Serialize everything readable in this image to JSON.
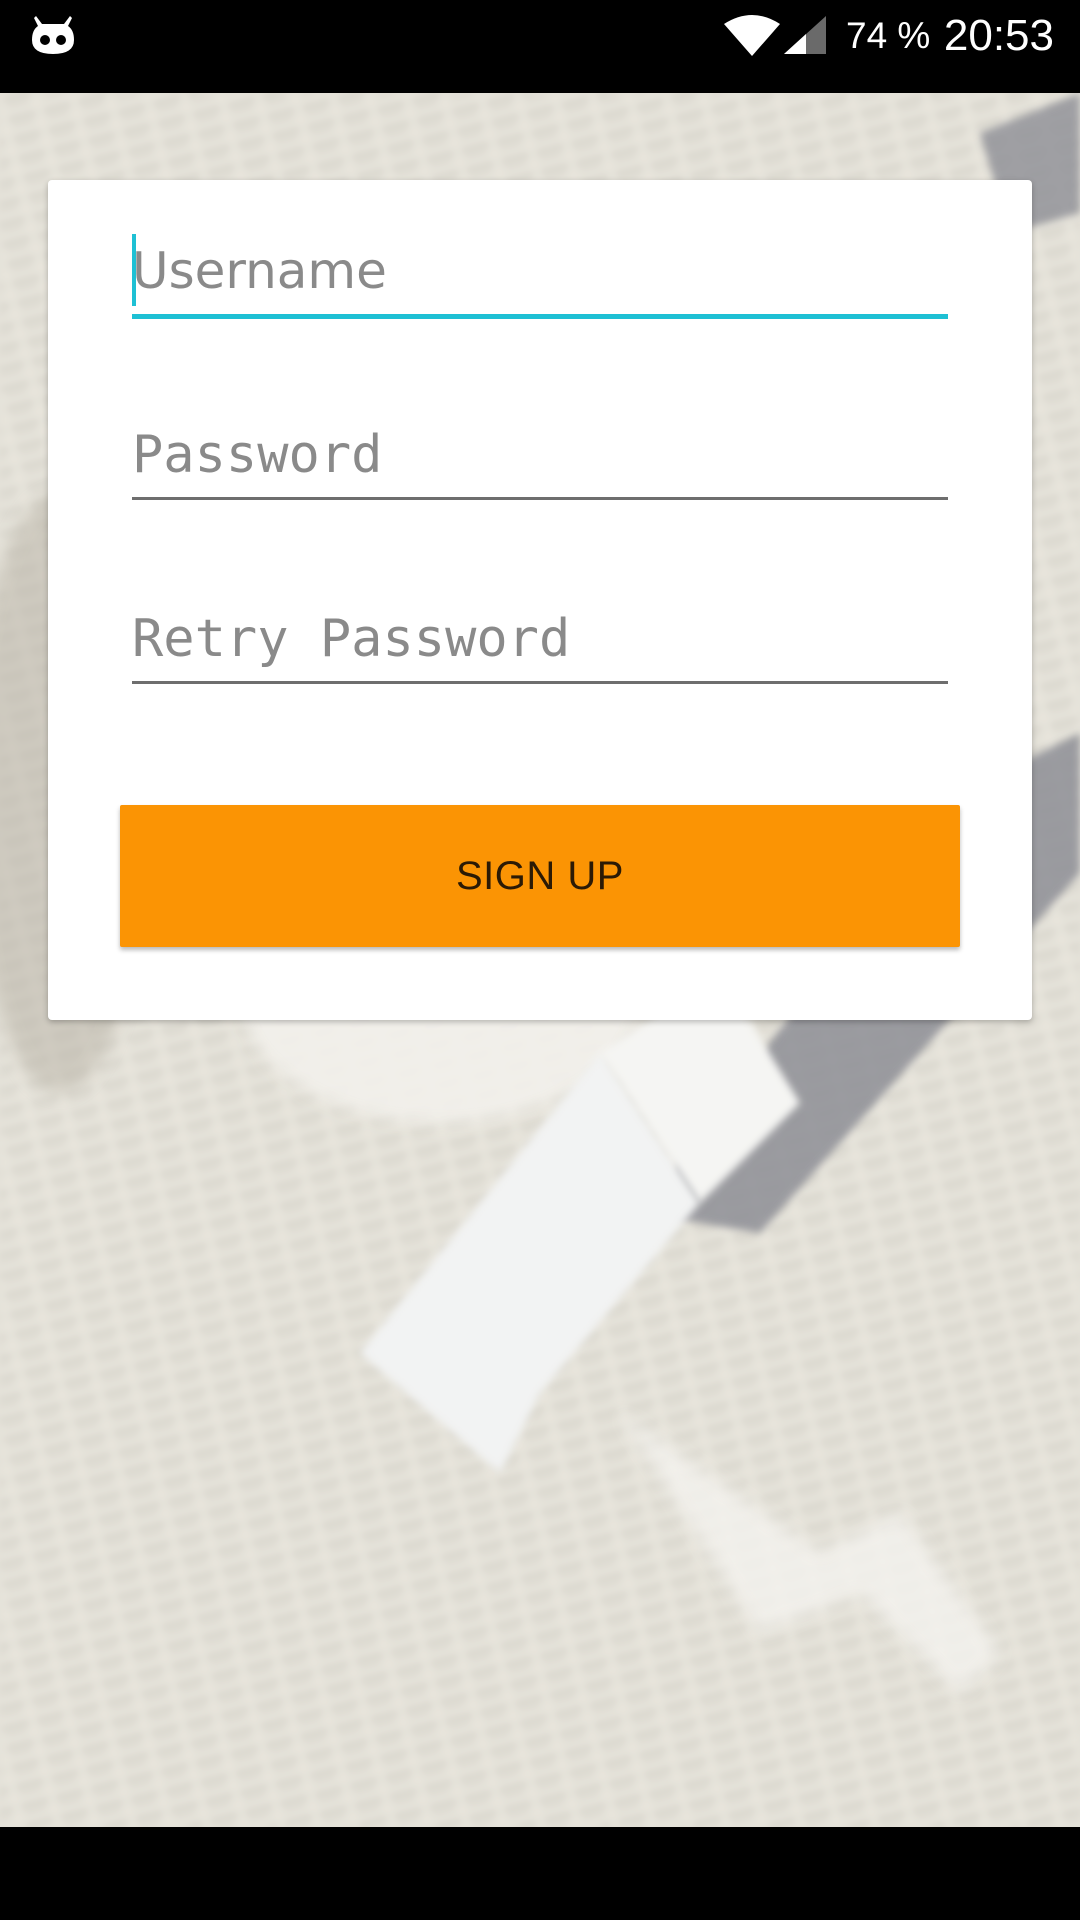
{
  "status_bar": {
    "app_icon": "cyanogen-mascot-icon",
    "wifi_icon": "wifi-icon",
    "signal_icon": "cell-signal-icon",
    "battery": "74 %",
    "time": "20:53"
  },
  "form": {
    "username": {
      "placeholder": "Username",
      "value": ""
    },
    "password": {
      "placeholder": "Password",
      "value": ""
    },
    "retry_password": {
      "placeholder": "Retry Password",
      "value": ""
    },
    "signup_label": "SIGN UP"
  },
  "colors": {
    "accent": "#1ec0d4",
    "button": "#fb9404",
    "background": "#dedbd2"
  }
}
